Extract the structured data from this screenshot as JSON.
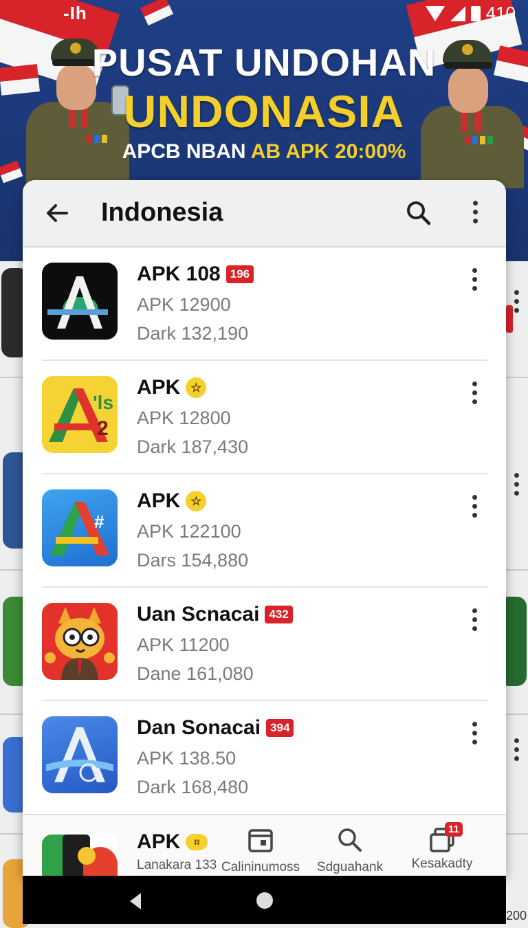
{
  "status_bar": {
    "left_text": "-Ih",
    "time": "410"
  },
  "banner": {
    "title_line1": "PUSAT UNDOHAN",
    "title_line2": "UNDONASIA",
    "subtitle_white": "APCB NBAN ",
    "subtitle_yellow": "AB APK 20:00%"
  },
  "app_bar": {
    "title": "Indonesia"
  },
  "apps": [
    {
      "name": "APK 108",
      "badge": "196",
      "line2": "APK 12900",
      "line3": "Dark 132,190",
      "icon": "apk-a-icon"
    },
    {
      "name": "APK",
      "badge_icon": "star",
      "line2": "APK 12800",
      "line3": "Dark 187,430",
      "icon": "apk-a-yellow-icon"
    },
    {
      "name": "APK",
      "badge_icon": "star",
      "line2": "APK 122100",
      "line3": "Dars 154,880",
      "icon": "apk-a-blue-icon"
    },
    {
      "name": "Uan Scnacai",
      "badge": "432",
      "line2": "APK 11200",
      "line3": "Dane 161,080",
      "icon": "owl-mascot-icon"
    },
    {
      "name": "Dan Sonacai",
      "badge": "394",
      "line2": "APK 138.50",
      "line3": "Dark 168,480",
      "icon": "apk-a-ribbon-icon"
    }
  ],
  "partial_app": {
    "name": "APK",
    "sub": "Lanakara 133"
  },
  "bottom_nav": {
    "item1_label": "Calininumoss",
    "item2_label": "Sdguahank",
    "item3_label": "Kesakadty",
    "item3_badge": "11"
  },
  "bg_corner_text": "200"
}
